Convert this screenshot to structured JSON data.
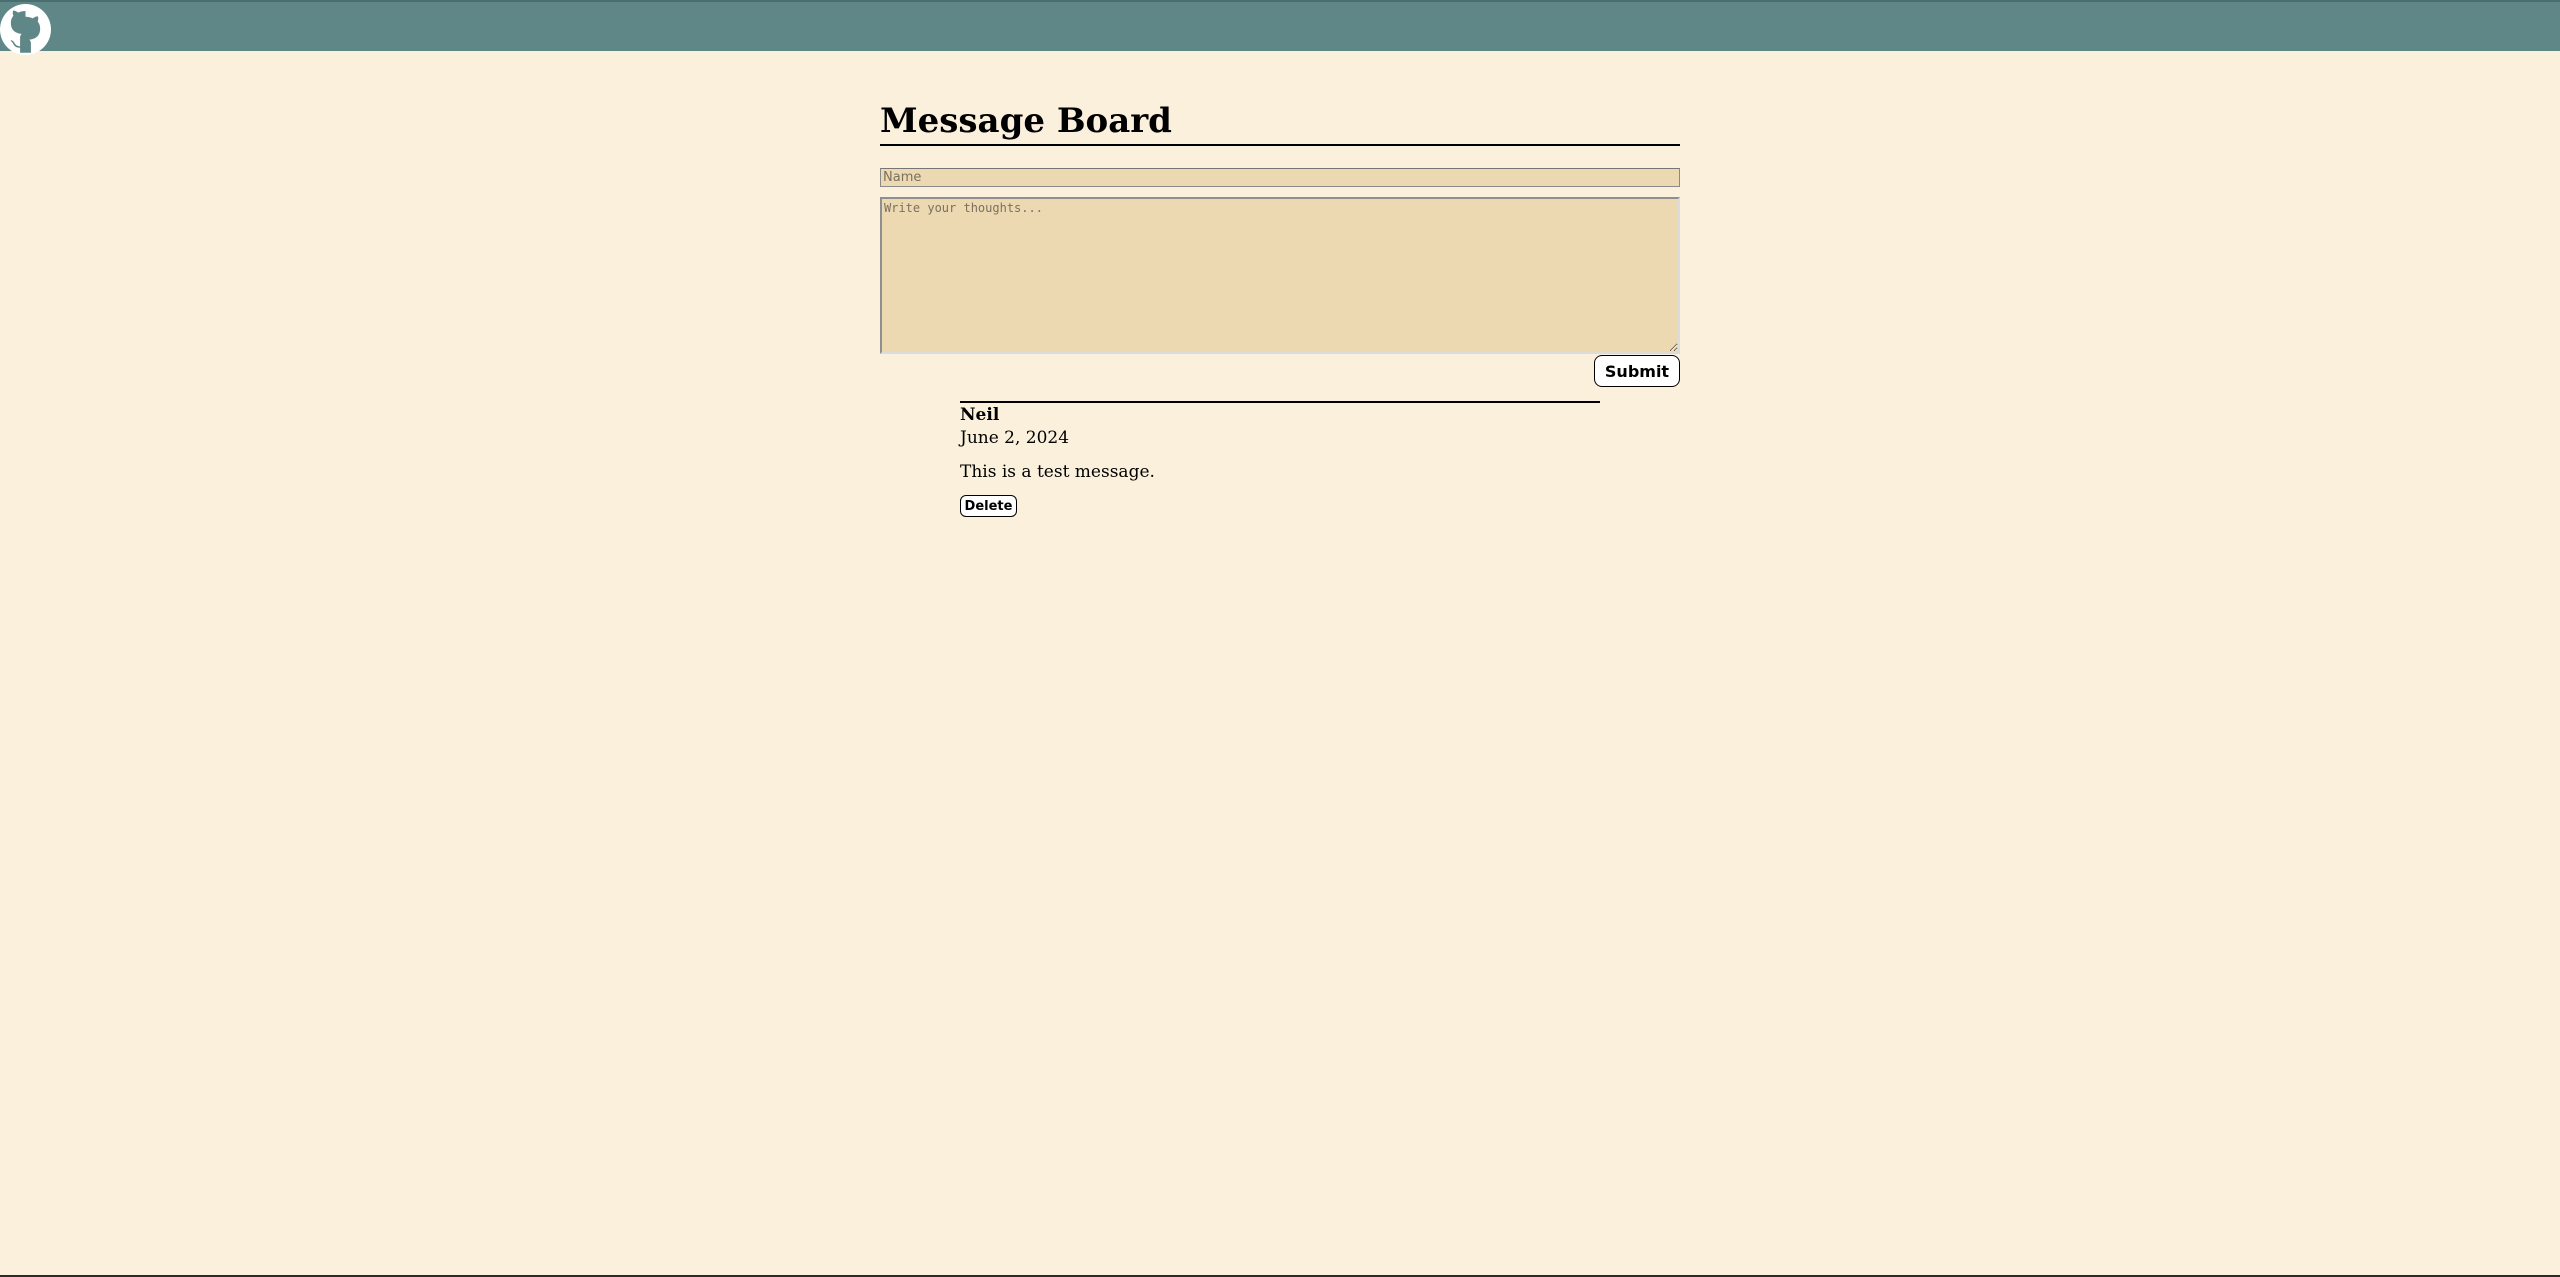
{
  "header": {
    "github_icon": "github-icon",
    "bar_color": "#5f8787"
  },
  "page": {
    "title": "Message Board",
    "background": "#faf0dc"
  },
  "form": {
    "name_placeholder": "Name",
    "name_value": "",
    "thoughts_placeholder": "Write your thoughts...",
    "thoughts_value": "",
    "submit_label": "Submit"
  },
  "messages": [
    {
      "author": "Neil",
      "date": "June 2, 2024",
      "body": "This is a test message.",
      "delete_label": "Delete"
    }
  ]
}
